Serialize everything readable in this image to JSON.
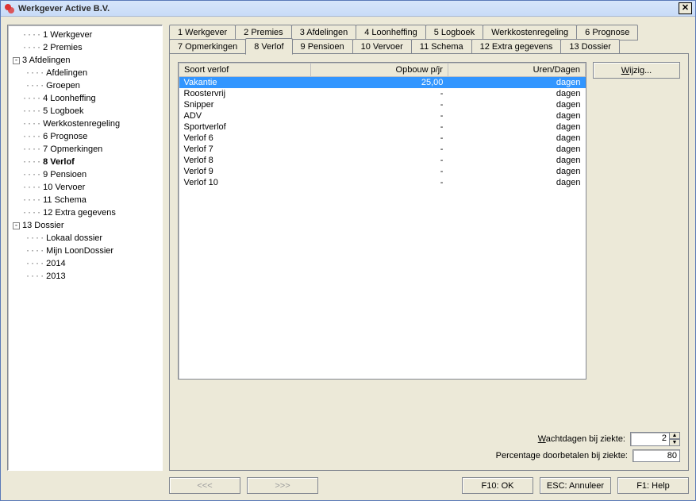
{
  "window": {
    "title": "Werkgever Active B.V."
  },
  "tree": [
    {
      "label": "1 Werkgever",
      "level": 1,
      "toggle": null
    },
    {
      "label": "2 Premies",
      "level": 1,
      "toggle": null
    },
    {
      "label": "3 Afdelingen",
      "level": 1,
      "toggle": "-",
      "hastoggle": true
    },
    {
      "label": "Afdelingen",
      "level": 2,
      "toggle": null
    },
    {
      "label": "Groepen",
      "level": 2,
      "toggle": null
    },
    {
      "label": "4 Loonheffing",
      "level": 1,
      "toggle": null
    },
    {
      "label": "5 Logboek",
      "level": 1,
      "toggle": null
    },
    {
      "label": "Werkkostenregeling",
      "level": 1,
      "toggle": null
    },
    {
      "label": "6  Prognose",
      "level": 1,
      "toggle": null
    },
    {
      "label": "7 Opmerkingen",
      "level": 1,
      "toggle": null
    },
    {
      "label": "8 Verlof",
      "level": 1,
      "toggle": null,
      "bold": true
    },
    {
      "label": "9 Pensioen",
      "level": 1,
      "toggle": null
    },
    {
      "label": "10 Vervoer",
      "level": 1,
      "toggle": null
    },
    {
      "label": "11 Schema",
      "level": 1,
      "toggle": null
    },
    {
      "label": "12 Extra gegevens",
      "level": 1,
      "toggle": null
    },
    {
      "label": "13 Dossier",
      "level": 1,
      "toggle": "-",
      "hastoggle": true
    },
    {
      "label": "Lokaal dossier",
      "level": 2,
      "toggle": null
    },
    {
      "label": "Mijn LoonDossier",
      "level": 2,
      "toggle": null
    },
    {
      "label": "2014",
      "level": 2,
      "toggle": null
    },
    {
      "label": "2013",
      "level": 2,
      "toggle": null
    }
  ],
  "tabs_row1": [
    {
      "label": "1 Werkgever"
    },
    {
      "label": "2 Premies"
    },
    {
      "label": "3 Afdelingen"
    },
    {
      "label": "4 Loonheffing"
    },
    {
      "label": "5 Logboek"
    },
    {
      "label": "Werkkostenregeling"
    },
    {
      "label": "6  Prognose"
    }
  ],
  "tabs_row2": [
    {
      "label": "7 Opmerkingen"
    },
    {
      "label": "8 Verlof",
      "active": true
    },
    {
      "label": "9 Pensioen"
    },
    {
      "label": "10 Vervoer"
    },
    {
      "label": "11 Schema"
    },
    {
      "label": "12 Extra gegevens"
    },
    {
      "label": "13 Dossier"
    }
  ],
  "table": {
    "headers": {
      "col1": "Soort verlof",
      "col2": "Opbouw p/jr",
      "col3": "Uren/Dagen"
    },
    "rows": [
      {
        "c1": "Vakantie",
        "c2": "25,00",
        "c3": "dagen",
        "sel": true
      },
      {
        "c1": "Roostervrij",
        "c2": "-",
        "c3": "dagen"
      },
      {
        "c1": "Snipper",
        "c2": "-",
        "c3": "dagen"
      },
      {
        "c1": "ADV",
        "c2": "-",
        "c3": "dagen"
      },
      {
        "c1": "Sportverlof",
        "c2": "-",
        "c3": "dagen"
      },
      {
        "c1": "Verlof 6",
        "c2": "-",
        "c3": "dagen"
      },
      {
        "c1": "Verlof 7",
        "c2": "-",
        "c3": "dagen"
      },
      {
        "c1": "Verlof 8",
        "c2": "-",
        "c3": "dagen"
      },
      {
        "c1": "Verlof 9",
        "c2": "-",
        "c3": "dagen"
      },
      {
        "c1": "Verlof 10",
        "c2": "-",
        "c3": "dagen"
      }
    ]
  },
  "side": {
    "wijzig_prefix": "W",
    "wijzig_rest": "ijzig..."
  },
  "form": {
    "wachtdagen_prefix": "W",
    "wachtdagen_rest": "achtdagen bij ziekte:",
    "wachtdagen_val": "2",
    "percentage_label": "Percentage doorbetalen bij ziekte:",
    "percentage_val": "80"
  },
  "bottom": {
    "prev": "<<<",
    "next": ">>>",
    "ok": "F10: OK",
    "cancel": "ESC: Annuleer",
    "help": "F1: Help"
  }
}
